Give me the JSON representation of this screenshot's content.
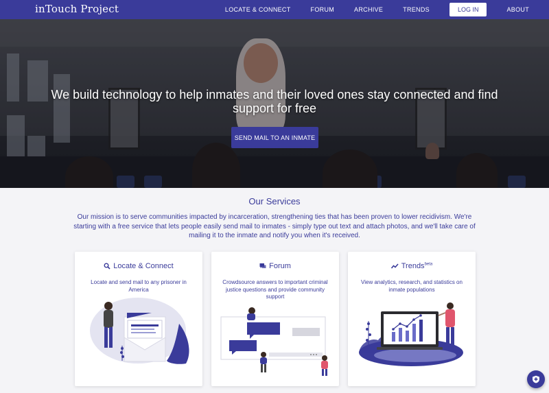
{
  "nav": {
    "brand": "inTouch Project",
    "links": [
      "LOCATE & CONNECT",
      "FORUM",
      "ARCHIVE",
      "TRENDS"
    ],
    "login": "LOG IN",
    "about": "ABOUT"
  },
  "hero": {
    "title": "We build technology to help inmates and their loved ones stay connected and find support for free",
    "cta": "SEND MAIL TO AN INMATE"
  },
  "services": {
    "title": "Our Services",
    "mission": "Our mission is to serve communities impacted by incarceration, strengthening ties that has been proven to lower recidivism. We're starting with a free service that lets people easily send mail to inmates - simply type out text and attach photos, and we'll take care of mailing it to the inmate and notify you when it's received.",
    "cards": [
      {
        "title": "Locate & Connect",
        "icon": "search-icon",
        "desc": "Locate and send mail to any prisoner in America"
      },
      {
        "title": "Forum",
        "icon": "forum-icon",
        "desc": "Crowdsource answers to important criminal justice questions and provide community support"
      },
      {
        "title": "Trends",
        "badge": "beta",
        "icon": "trend-icon",
        "desc": "View analytics, research, and statistics on inmate populations"
      }
    ]
  },
  "colors": {
    "brand": "#3a3b9a",
    "background": "#f4f4f7"
  }
}
